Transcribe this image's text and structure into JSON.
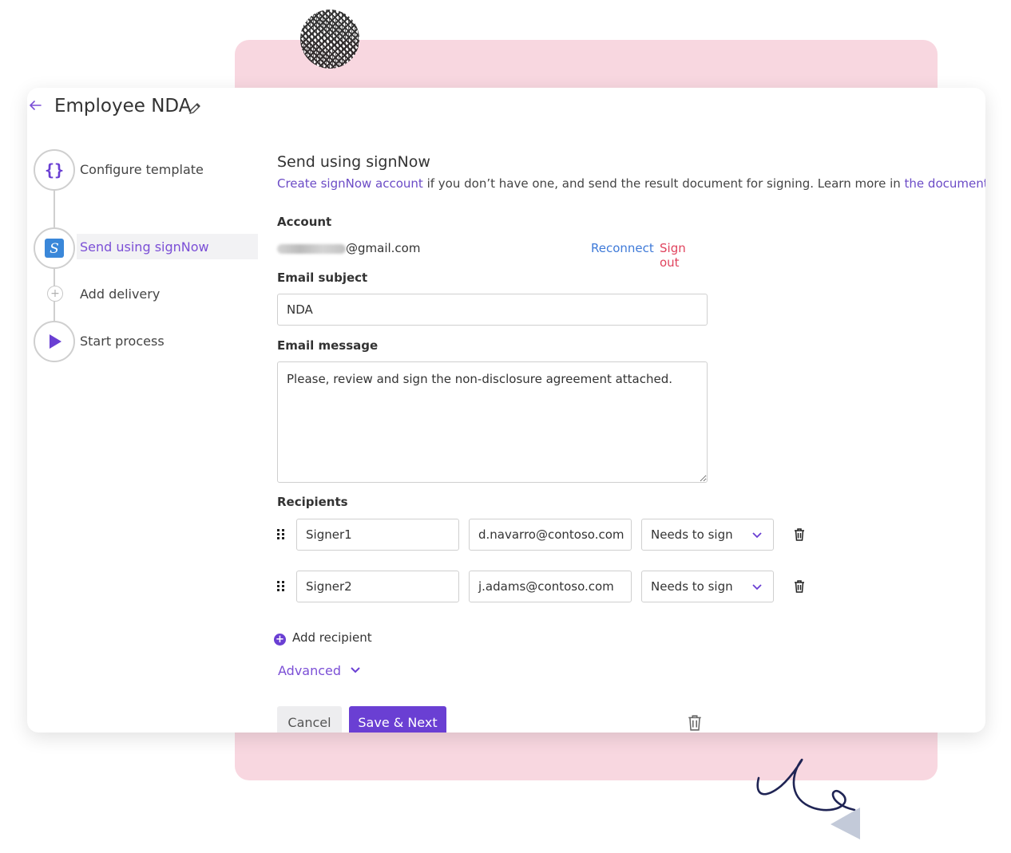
{
  "header": {
    "title": "Employee NDA"
  },
  "steps": [
    {
      "label": "Configure template",
      "icon": "braces-icon"
    },
    {
      "label": "Send using signNow",
      "icon": "signnow-logo-icon",
      "active": true
    },
    {
      "label": "Add delivery",
      "icon": "plus-circle-icon"
    },
    {
      "label": "Start process",
      "icon": "play-icon"
    }
  ],
  "main": {
    "title": "Send using signNow",
    "desc_link1": "Create signNow account",
    "desc_middle": " if you don’t have one, and send the result document for signing. Learn more in ",
    "desc_link2": "the documentation",
    "desc_end": ".",
    "account_label": "Account",
    "account_email_suffix": "@gmail.com",
    "reconnect": "Reconnect",
    "signout": "Sign out",
    "subject_label": "Email subject",
    "subject_value": "NDA",
    "message_label": "Email message",
    "message_value": "Please, review and sign the non-disclosure agreement attached.",
    "recipients_label": "Recipients",
    "recipients": [
      {
        "name": "Signer1",
        "email": "d.navarro@contoso.com",
        "role": "Needs to sign"
      },
      {
        "name": "Signer2",
        "email": "j.adams@contoso.com",
        "role": "Needs to sign"
      }
    ],
    "add_recipient": "Add recipient",
    "advanced": "Advanced",
    "cancel": "Cancel",
    "save_next": "Save & Next"
  },
  "colors": {
    "accent": "#6a3fd3",
    "link": "#3f7ad8",
    "danger": "#e0435d",
    "pink_bg": "#f8d7e0"
  }
}
